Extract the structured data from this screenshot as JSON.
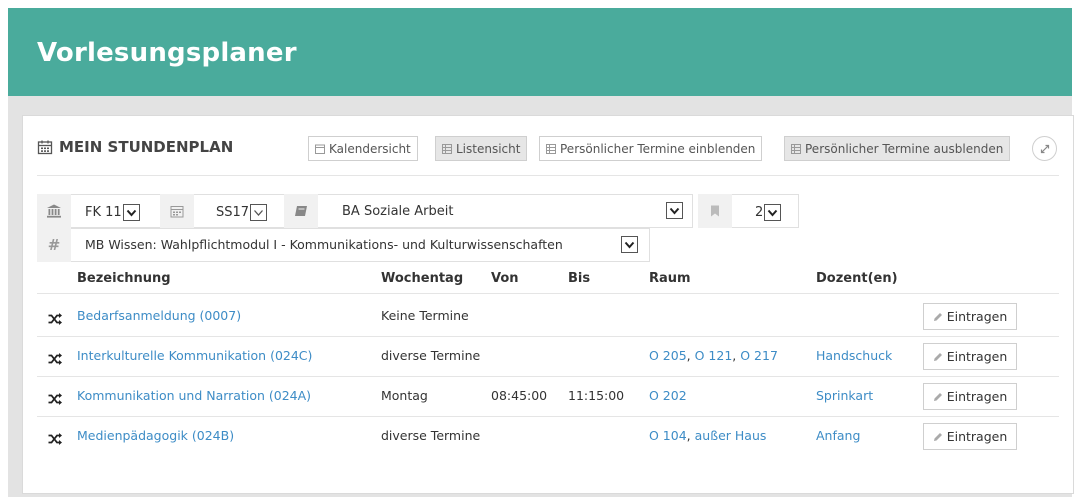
{
  "header": {
    "title": "Vorlesungsplaner"
  },
  "card": {
    "title": "MEIN STUNDENPLAN",
    "buttons": {
      "calendar_view": "Kalendersicht",
      "list_view": "Listensicht",
      "show_personal": "Persönlicher Termine einblenden",
      "hide_personal": "Persönlicher Termine ausblenden"
    }
  },
  "filters": {
    "faculty": "FK 11",
    "semester": "SS17",
    "program": "BA Soziale Arbeit",
    "level": "2",
    "module": "MB Wissen: Wahlpflichtmodul I - Kommunikations- und Kulturwissenschaften"
  },
  "table": {
    "headers": {
      "name": "Bezeichnung",
      "weekday": "Wochentag",
      "from": "Von",
      "to": "Bis",
      "room": "Raum",
      "lecturer": "Dozent(en)"
    },
    "action_label": "Eintragen",
    "rows": [
      {
        "name": "Bedarfsanmeldung (0007)",
        "weekday": "Keine Termine",
        "from": "",
        "to": "",
        "rooms": [],
        "lecturer": ""
      },
      {
        "name": "Interkulturelle Kommunikation (024C)",
        "weekday": "diverse Termine",
        "from": "",
        "to": "",
        "rooms": [
          "O 205",
          "O 121",
          "O 217"
        ],
        "lecturer": "Handschuck"
      },
      {
        "name": "Kommunikation und Narration (024A)",
        "weekday": "Montag",
        "from": "08:45:00",
        "to": "11:15:00",
        "rooms": [
          "O 202"
        ],
        "lecturer": "Sprinkart"
      },
      {
        "name": "Medienpädagogik (024B)",
        "weekday": "diverse Termine",
        "from": "",
        "to": "",
        "rooms": [
          "O 104",
          "außer Haus"
        ],
        "lecturer": "Anfang"
      }
    ]
  },
  "colors": {
    "brand": "#4aab9c",
    "link": "#3d8cc6"
  }
}
